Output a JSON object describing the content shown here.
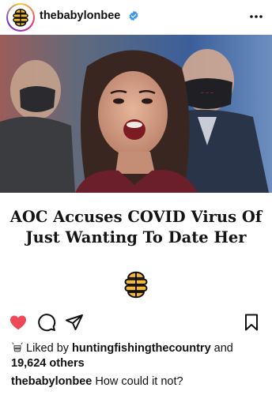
{
  "post": {
    "username": "thebabylonbee",
    "verified": true,
    "more_icon": "more-horizontal-icon",
    "avatar_icon": "babylon-bee-logo",
    "image_alt_icon": "news-photo",
    "headline_line1": "AOC Accuses COVID Virus Of",
    "headline_line2": "Just Wanting To Date Her"
  },
  "actions": {
    "like_icon": "heart-filled-icon",
    "comment_icon": "comment-icon",
    "share_icon": "send-icon",
    "save_icon": "bookmark-icon",
    "like_color": "#ed4956"
  },
  "likes": {
    "prefix": "Liked by",
    "user": "huntingfishingthecountry",
    "connector": "and",
    "others": "19,624 others"
  },
  "caption": {
    "username": "thebabylonbee",
    "text": "How could it not?"
  },
  "colors": {
    "bee_yellow": "#f5b82e",
    "text": "#111111",
    "verified_blue": "#3897f0"
  }
}
